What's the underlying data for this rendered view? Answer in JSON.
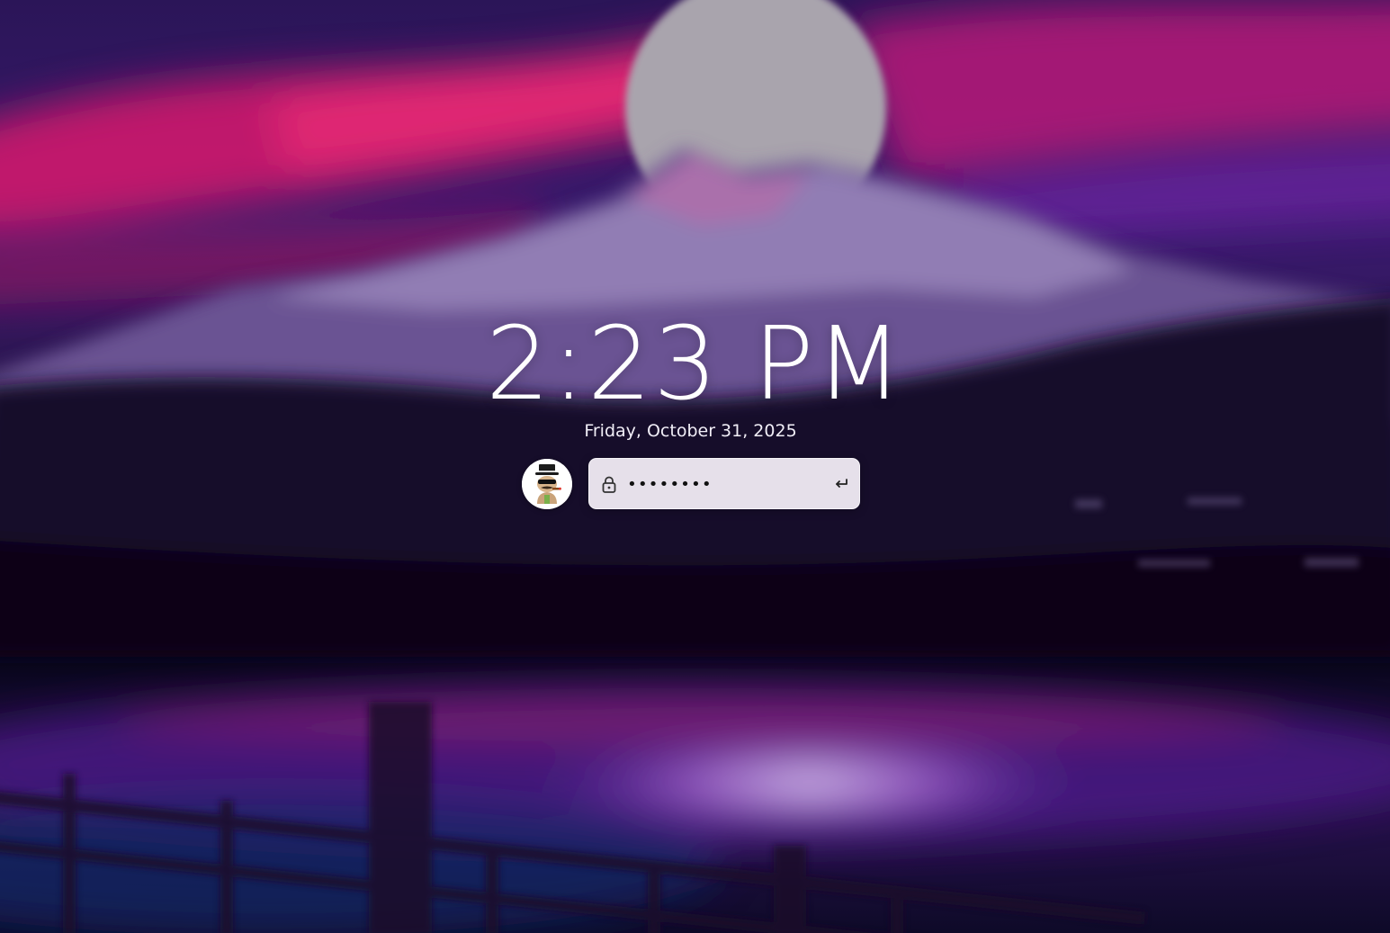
{
  "lock_screen": {
    "time": "2:23 PM",
    "date": "Friday, October 31, 2025",
    "password_value": "••••••••",
    "password_placeholder": ""
  },
  "icons": {
    "avatar": "user-avatar",
    "lock": "lock-icon",
    "submit": "enter-arrow-icon"
  },
  "colors": {
    "sky_pink": "#d81b6c",
    "sky_purple": "#3a1a6e",
    "moon": "#a9a4ad",
    "field_bg": "#e6e0ea",
    "text": "#ffffff"
  }
}
